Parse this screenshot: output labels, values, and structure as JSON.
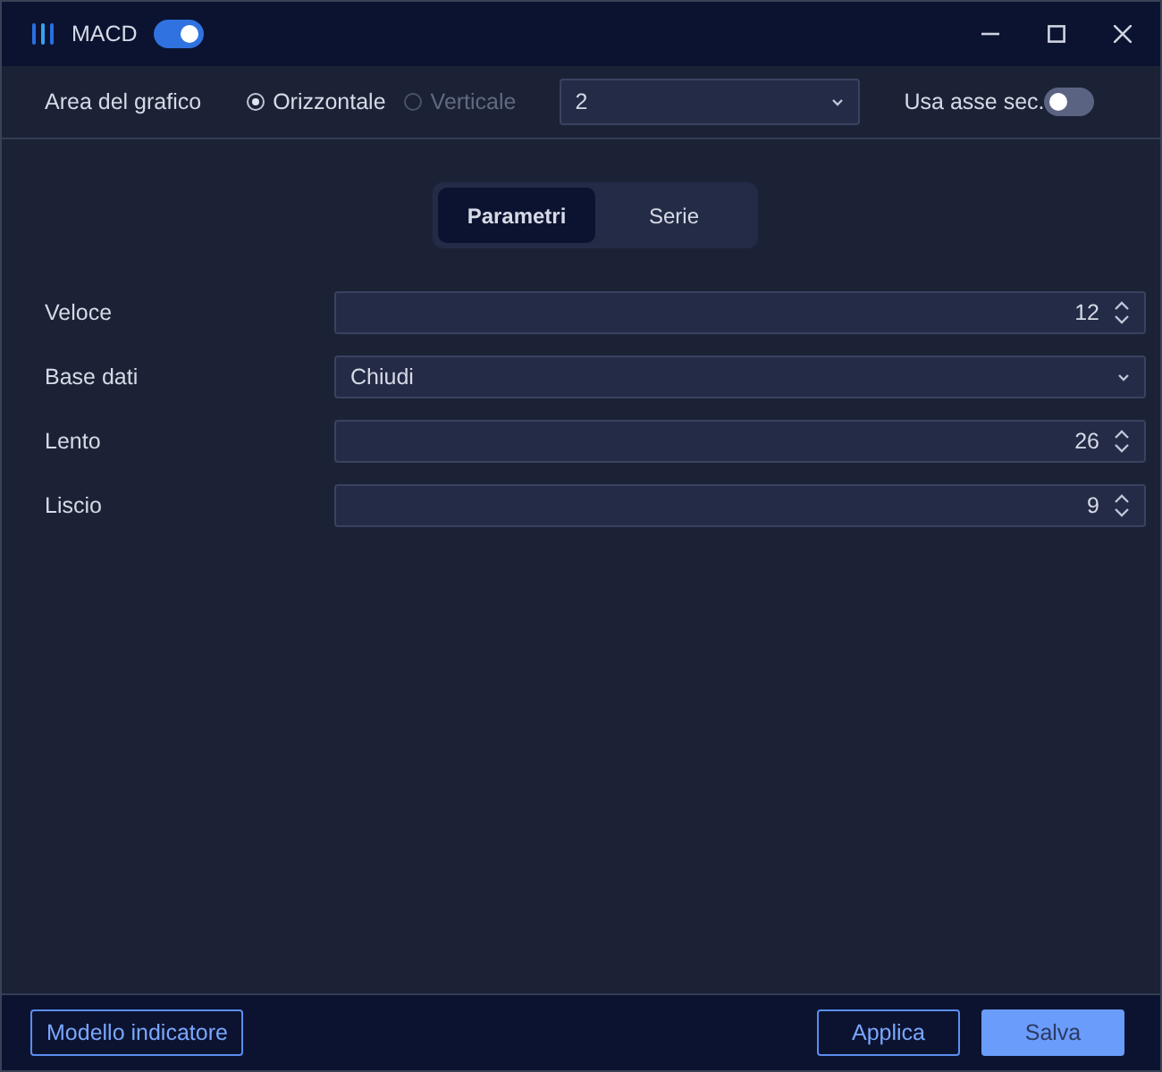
{
  "window": {
    "title": "MACD",
    "enabled": true
  },
  "chart_area": {
    "label": "Area del grafico",
    "orientations": [
      {
        "label": "Orizzontale",
        "selected": true,
        "disabled": false
      },
      {
        "label": "Verticale",
        "selected": false,
        "disabled": true
      }
    ],
    "pane": "2",
    "secondary_axis": {
      "label": "Usa asse sec.",
      "on": false
    }
  },
  "tabs": [
    {
      "label": "Parametri",
      "selected": true
    },
    {
      "label": "Serie",
      "selected": false
    }
  ],
  "fields": [
    {
      "label": "Veloce",
      "kind": "number",
      "value": "12"
    },
    {
      "label": "Base dati",
      "kind": "select",
      "value": "Chiudi"
    },
    {
      "label": "Lento",
      "kind": "number",
      "value": "26"
    },
    {
      "label": "Liscio",
      "kind": "number",
      "value": "9"
    }
  ],
  "footer": {
    "template_button": "Modello indicatore",
    "buttons": [
      {
        "label": "Applica",
        "kind": "secondary"
      },
      {
        "label": "Salva",
        "kind": "primary"
      }
    ]
  }
}
